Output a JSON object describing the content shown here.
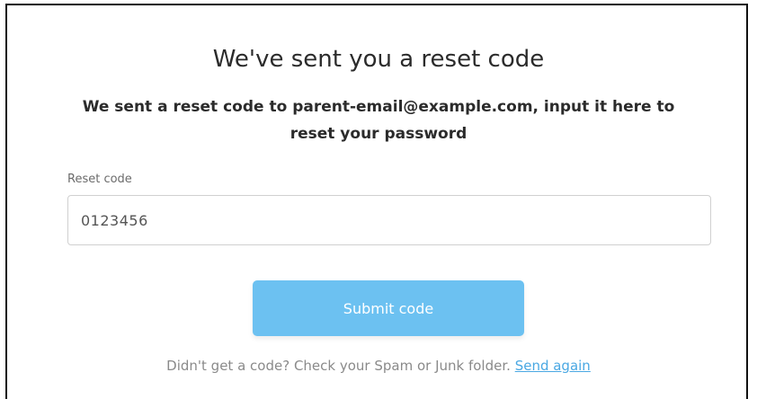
{
  "page": {
    "title": "We've sent you a reset code",
    "subtitle": "We sent a reset code to parent-email@example.com, input it here to reset your password"
  },
  "form": {
    "reset_code_label": "Reset code",
    "reset_code_value": "0123456",
    "submit_label": "Submit code"
  },
  "footer": {
    "text": "Didn't get a code? Check your Spam or Junk folder.",
    "send_again_link": "Send again"
  },
  "colors": {
    "button_background": "#6cc1f1",
    "link": "#4aa8e3",
    "text_primary": "#2b2b2b",
    "text_muted": "#8a8a8a"
  }
}
